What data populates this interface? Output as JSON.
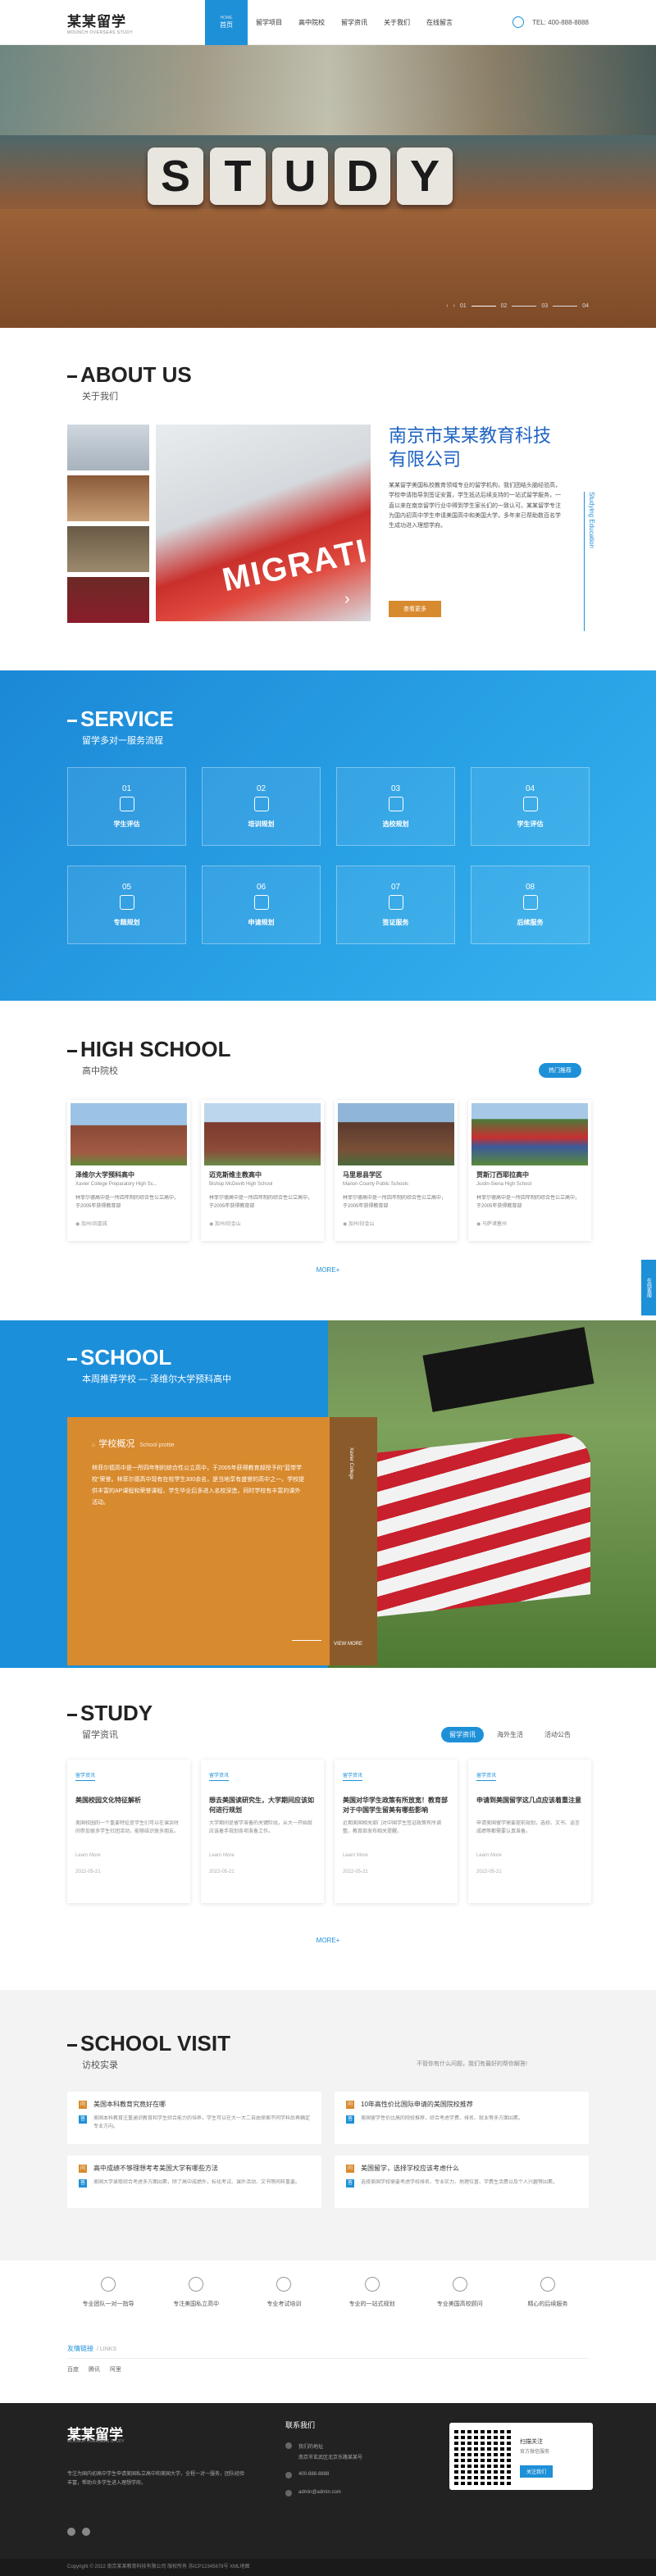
{
  "header": {
    "logo": "某某留学",
    "logo_sub": "MOUNCH OVERSEAS STUDY",
    "nav": [
      {
        "en": "HOME",
        "label": "首页"
      },
      {
        "label": "留学项目"
      },
      {
        "label": "高中院校"
      },
      {
        "label": "留学资讯"
      },
      {
        "label": "关于我们"
      },
      {
        "label": "在线留言"
      }
    ],
    "tel": "TEL: 400-888-8888"
  },
  "banner": {
    "word": [
      "S",
      "T",
      "U",
      "D",
      "Y"
    ],
    "dots": [
      "01",
      "02",
      "03",
      "04"
    ]
  },
  "about": {
    "title_en": "ABOUT US",
    "title_cn": "关于我们",
    "company": "南京市某某教育科技有限公司",
    "desc": "某某留学美国私校教育领域专业的留学机构，我们团结头脑经验高，学校申请指导到签证安置，学生抵达后续支持的一站式留学服务，一直以来在南京留学行业中得到学生家长们的一致认可。某某留学专注为国内初高中学生申请美国高中和美国大学，多年来已帮助数百名学生成功进入理想学府。",
    "more": "查看更多",
    "vertical": "Studying Education"
  },
  "service": {
    "title_en": "SERVICE",
    "title_cn": "留学多对一服务流程",
    "items": [
      {
        "num": "01",
        "label": "学生评估"
      },
      {
        "num": "02",
        "label": "培训规划"
      },
      {
        "num": "03",
        "label": "选校规划"
      },
      {
        "num": "04",
        "label": "学生评估"
      },
      {
        "num": "05",
        "label": "专题规划"
      },
      {
        "num": "06",
        "label": "申请规划"
      },
      {
        "num": "07",
        "label": "签证服务"
      },
      {
        "num": "08",
        "label": "后续服务"
      }
    ]
  },
  "highschool": {
    "title_en": "HIGH SCHOOL",
    "title_cn": "高中院校",
    "tag": "热门推荐",
    "cards": [
      {
        "name": "泽维尔大学预科高中",
        "en": "Xavier College Preparatory High Sc...",
        "desc": "林菲尔德高中是一所四年制的综合性公立高中，于2005年获得教育部",
        "loc": "加州/凤凰城"
      },
      {
        "name": "迈克斯维主教高中",
        "en": "Bishop McDevitt High School",
        "desc": "林菲尔德高中是一所四年制的综合性公立高中，于2005年获得教育部",
        "loc": "加州/旧金山"
      },
      {
        "name": "马里恩县学区",
        "en": "Marion County Public Schools",
        "desc": "林菲尔德高中是一所四年制的综合性公立高中，于2005年获得教育部",
        "loc": "加州/旧金山"
      },
      {
        "name": "贾斯汀西耶拉高中",
        "en": "Justin-Siena High School",
        "desc": "林菲尔德高中是一所四年制的综合性公立高中，于2005年获得教育部",
        "loc": "马萨诸塞州"
      }
    ],
    "more": "MORE+"
  },
  "school": {
    "title_en": "SCHOOL",
    "title_cn": "本周推荐学校 — 泽维尔大学预科高中",
    "card_title": "学校概况",
    "card_sub": "School profile",
    "desc": "林菲尔德高中是一所四年制的综合性公立高中，于2005年获得教育部授予的\"蓝带学校\"荣誉。林菲尔德高中现有在校学生300余名，是当地享有盛誉的高中之一。学校提供丰富的AP课程和荣誉课程，学生毕业后多进入名校深造，同时学校有丰富的课外活动。",
    "side": "Xavier College",
    "view_more": "VIEW MORE"
  },
  "study": {
    "title_en": "STUDY",
    "title_cn": "留学资讯",
    "tabs": [
      "留学资讯",
      "海外生活",
      "活动公告"
    ],
    "news": [
      {
        "cat": "留学资讯",
        "title": "美国校园文化特征解析",
        "desc": "美国校园的一个重要特征是学生们可以在课余时间参加很多学生社团活动，能够结识很多朋友。",
        "more": "Learn More",
        "date": "2022-05-21"
      },
      {
        "cat": "留学资讯",
        "title": "想去美国读研究生，大学期间应该如何进行规划",
        "desc": "大学期间是留学准备的关键阶段，从大一开始就应该着手规划各项准备工作。",
        "more": "Learn More",
        "date": "2022-05-21"
      },
      {
        "cat": "留学资讯",
        "title": "美国对华学生政策有所放宽！教育部对于中国学生留美有哪些影响",
        "desc": "近期美国相关部门对中国学生签证政策有所调整，教育部发布相关提醒。",
        "more": "Learn More",
        "date": "2022-05-21"
      },
      {
        "cat": "留学资讯",
        "title": "申请到美国留学这几点应该着重注意",
        "desc": "申请美国留学需要提前规划，选校、文书、语言成绩等都需要认真准备。",
        "more": "Learn More",
        "date": "2022-05-21"
      }
    ],
    "more": "MORE+"
  },
  "visit": {
    "title_en": "SCHOOL VISIT",
    "title_cn": "访校实录",
    "note": "不管你有什么问题，我们有最好的帮你解答!",
    "items": [
      {
        "q": "美国本科教育究竟好在哪",
        "a": "美国本科教育注重通识教育和学生综合能力的培养，学生可以在大一大二自由探索不同学科后再确定专业方向。"
      },
      {
        "q": "10年高性价比国际申请的美国院校推荐",
        "a": "美国留学性价比高的院校推荐，综合考虑学费、排名、就业等多方面因素。"
      },
      {
        "q": "高中成绩不够理想考考美国大学有哪些方法",
        "a": "美国大学录取综合考虑多方面因素，除了高中成绩外，标化考试、课外活动、文书等同样重要。"
      },
      {
        "q": "美国留学，选择学校应该考虑什么",
        "a": "选择美国学校需要考虑学校排名、专业实力、地理位置、学费生活费以及个人兴趣等因素。"
      }
    ]
  },
  "features": [
    {
      "icon": "user-icon",
      "label": "专业团队一对一指导"
    },
    {
      "icon": "building-icon",
      "label": "专注美国私立高中"
    },
    {
      "icon": "graduation-icon",
      "label": "专业考试培训"
    },
    {
      "icon": "bulb-icon",
      "label": "专业的一站式规划"
    },
    {
      "icon": "person-icon",
      "label": "专业美国高校顾问"
    },
    {
      "icon": "heart-icon",
      "label": "精心的后续服务"
    }
  ],
  "links": {
    "title": "友情链接",
    "sub": "/ LINKS",
    "items": [
      "百度",
      "腾讯",
      "阿里"
    ]
  },
  "footer": {
    "logo": "某某留学",
    "sub": "MOUNCH OVERSEAS STUDY",
    "desc": "专注为国内初高中学生申请美国私立高中和美国大学，全程一对一服务，团队经验丰富，帮助众多学生进入理想学府。",
    "contact_title": "联系我们",
    "contact": [
      "我们的地址",
      "南京市玄武区北京东路某某号",
      "400-888-8888",
      "admin@admin.com"
    ],
    "qr_t1": "扫描关注",
    "qr_t2": "官方微信服务",
    "qr_btn": "关注我们",
    "copyright": "Copyright © 2022 南京某某教育科技有限公司 版权所有 苏ICP12345678号 XML地图"
  },
  "float_tab": "在线客服"
}
